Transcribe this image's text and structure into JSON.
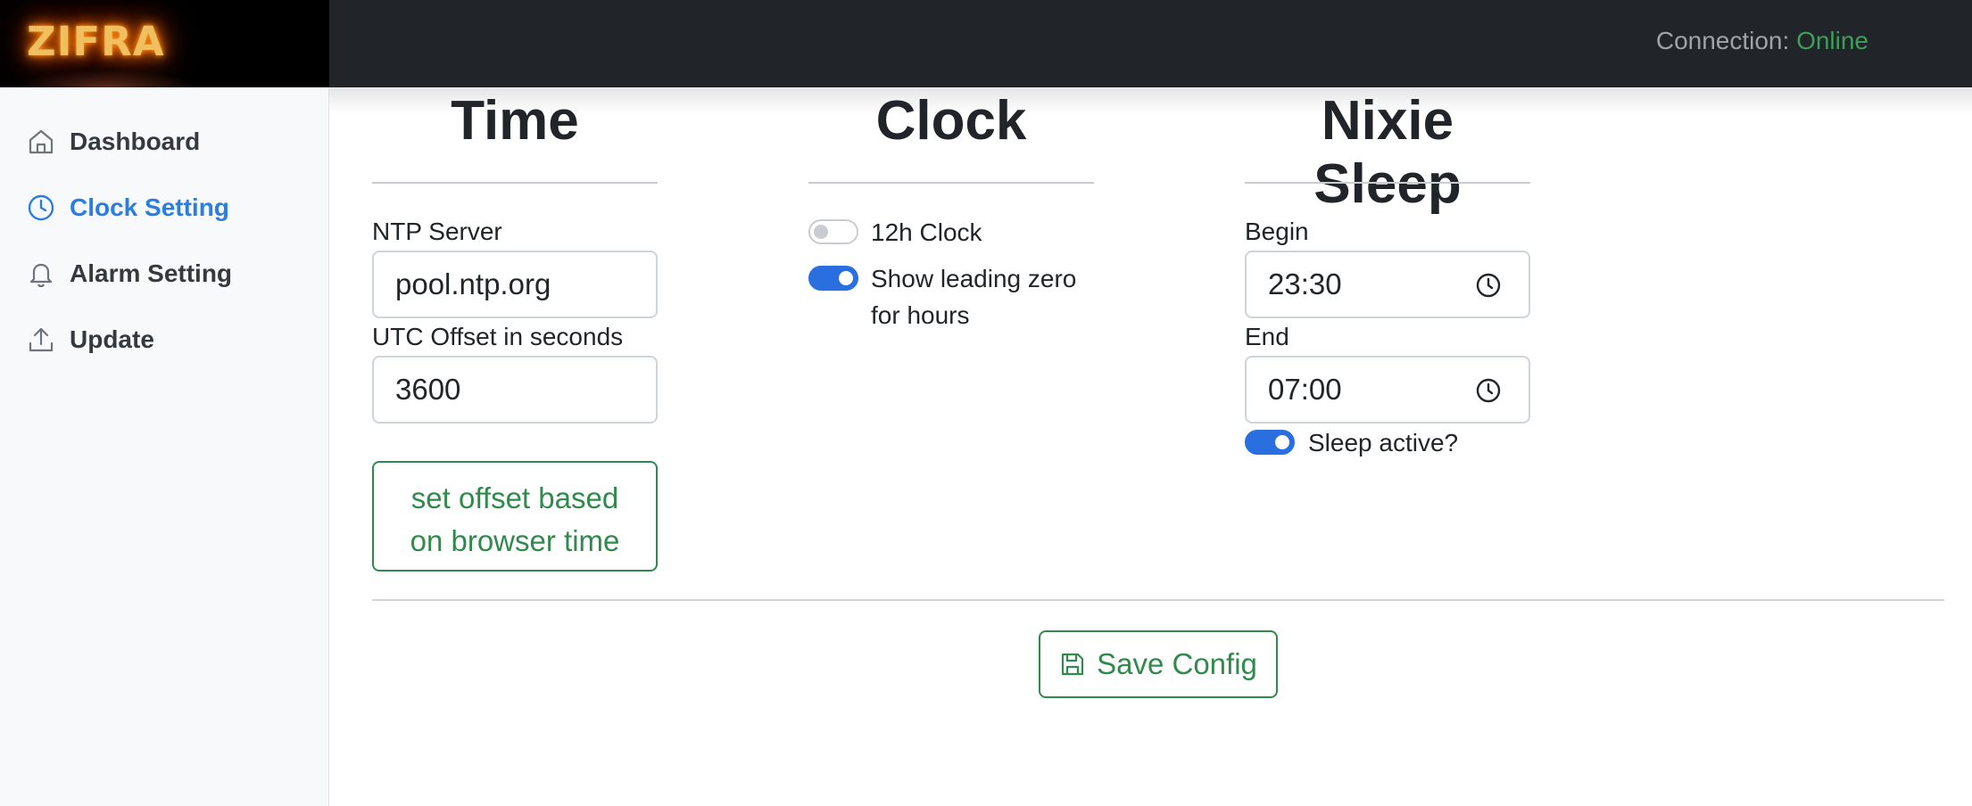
{
  "header": {
    "brand": "ZIFRA",
    "connection_label": "Connection:",
    "connection_status": "Online"
  },
  "sidebar": {
    "items": [
      {
        "label": "Dashboard",
        "icon": "home-icon",
        "active": false
      },
      {
        "label": "Clock Setting",
        "icon": "clock-icon",
        "active": true
      },
      {
        "label": "Alarm Setting",
        "icon": "bell-icon",
        "active": false
      },
      {
        "label": "Update",
        "icon": "upload-icon",
        "active": false
      }
    ]
  },
  "time": {
    "title": "Time",
    "ntp_label": "NTP Server",
    "ntp_value": "pool.ntp.org",
    "utc_label": "UTC Offset in seconds",
    "utc_value": "3600",
    "offset_button_line1": "set offset based",
    "offset_button_line2": "on browser time"
  },
  "clock": {
    "title": "Clock",
    "toggle_12h_label": "12h Clock",
    "toggle_12h_on": false,
    "toggle_zero_label_line1": "Show leading zero",
    "toggle_zero_label_line2": "for hours",
    "toggle_zero_on": true
  },
  "sleep": {
    "title": "Nixie Sleep",
    "begin_label": "Begin",
    "begin_value": "23:30",
    "end_label": "End",
    "end_value": "07:00",
    "active_label": "Sleep active?",
    "active_on": true
  },
  "actions": {
    "save_label": "Save Config"
  },
  "colors": {
    "accent": "#2a7de1",
    "success": "#2f8a4b",
    "toggle_on": "#2a6fe0"
  }
}
